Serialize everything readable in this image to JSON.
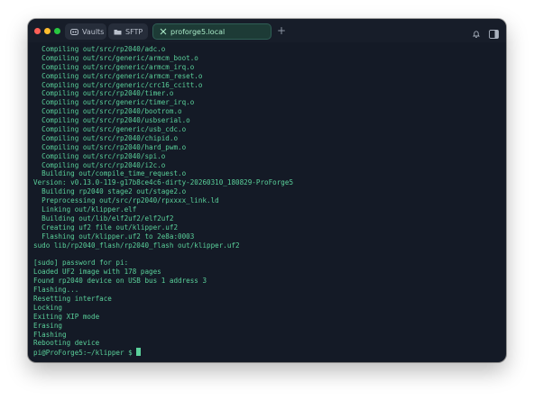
{
  "window": {
    "tabs": [
      {
        "label": "Vaults",
        "icon": "vault-icon"
      },
      {
        "label": "SFTP",
        "icon": "folder-icon"
      },
      {
        "label": "proforge5.local",
        "icon": "close-icon",
        "active": true
      }
    ],
    "new_tab": "+",
    "colors": {
      "background": "#141a26",
      "terminal_text": "#5ad09a",
      "active_tab": "#1d3b36"
    }
  },
  "terminal": {
    "lines": [
      "  Compiling out/src/rp2040/adc.o",
      "  Compiling out/src/generic/armcm_boot.o",
      "  Compiling out/src/generic/armcm_irq.o",
      "  Compiling out/src/generic/armcm_reset.o",
      "  Compiling out/src/generic/crc16_ccitt.o",
      "  Compiling out/src/rp2040/timer.o",
      "  Compiling out/src/generic/timer_irq.o",
      "  Compiling out/src/rp2040/bootrom.o",
      "  Compiling out/src/rp2040/usbserial.o",
      "  Compiling out/src/generic/usb_cdc.o",
      "  Compiling out/src/rp2040/chipid.o",
      "  Compiling out/src/rp2040/hard_pwm.o",
      "  Compiling out/src/rp2040/spi.o",
      "  Compiling out/src/rp2040/i2c.o",
      "  Building out/compile_time_request.o",
      "Version: v0.13.0-119-g17b8ce4c6-dirty-20260310_180829-ProForge5",
      "  Building rp2040 stage2 out/stage2.o",
      "  Preprocessing out/src/rp2040/rpxxxx_link.ld",
      "  Linking out/klipper.elf",
      "  Building out/lib/elf2uf2/elf2uf2",
      "  Creating uf2 file out/klipper.uf2",
      "  Flashing out/klipper.uf2 to 2e8a:0003",
      "sudo lib/rp2040_flash/rp2040_flash out/klipper.uf2",
      "",
      "[sudo] password for pi:",
      "Loaded UF2 image with 178 pages",
      "Found rp2040 device on USB bus 1 address 3",
      "Flashing...",
      "Resetting interface",
      "Locking",
      "Exiting XIP mode",
      "Erasing",
      "Flashing",
      "Rebooting device"
    ],
    "prompt": "pi@ProForge5:~/klipper $ "
  }
}
